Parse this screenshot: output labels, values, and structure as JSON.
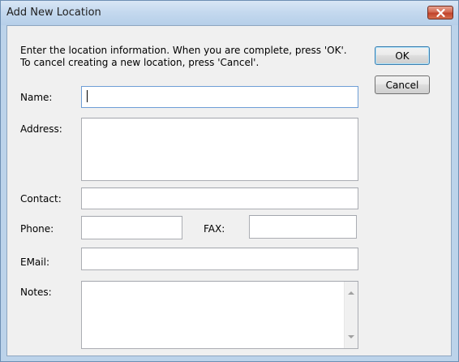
{
  "window": {
    "title": "Add New Location"
  },
  "dialog": {
    "instructions": "Enter the location information. When you are complete, press 'OK'.\nTo cancel creating a new location, press 'Cancel'.",
    "ok_label": "OK",
    "cancel_label": "Cancel"
  },
  "form": {
    "name_label": "Name:",
    "name_value": "",
    "address_label": "Address:",
    "address_value": "",
    "contact_label": "Contact:",
    "contact_value": "",
    "phone_label": "Phone:",
    "phone_value": "",
    "fax_label": "FAX:",
    "fax_value": "",
    "email_label": "EMail:",
    "email_value": "",
    "notes_label": "Notes:",
    "notes_value": ""
  },
  "icons": {
    "close": "close-icon",
    "scroll_up": "scroll-up-arrow-icon",
    "scroll_down": "scroll-down-arrow-icon"
  },
  "colors": {
    "close_button": "#c1432b",
    "focus_border": "#6e9ed6",
    "ok_border": "#3c7fb1"
  }
}
